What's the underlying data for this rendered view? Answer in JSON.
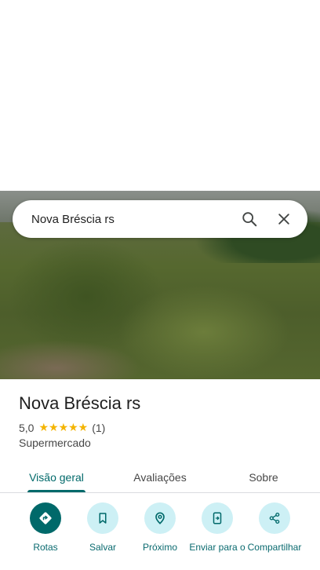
{
  "search": {
    "query": "Nova Bréscia rs"
  },
  "place": {
    "title": "Nova Bréscia rs",
    "rating": "5,0",
    "stars": "★★★★★",
    "review_count": "(1)",
    "category": "Supermercado"
  },
  "tabs": [
    {
      "label": "Visão geral",
      "active": true
    },
    {
      "label": "Avaliações",
      "active": false
    },
    {
      "label": "Sobre",
      "active": false
    }
  ],
  "actions": [
    {
      "label": "Rotas",
      "icon": "directions-icon"
    },
    {
      "label": "Salvar",
      "icon": "bookmark-icon"
    },
    {
      "label": "Próximo",
      "icon": "nearby-icon"
    },
    {
      "label": "Enviar para o",
      "icon": "send-to-phone-icon"
    },
    {
      "label": "Compartilhar",
      "icon": "share-icon"
    }
  ],
  "colors": {
    "accent": "#00696a",
    "action_bg": "#cdf0f5",
    "star": "#f4b400"
  }
}
